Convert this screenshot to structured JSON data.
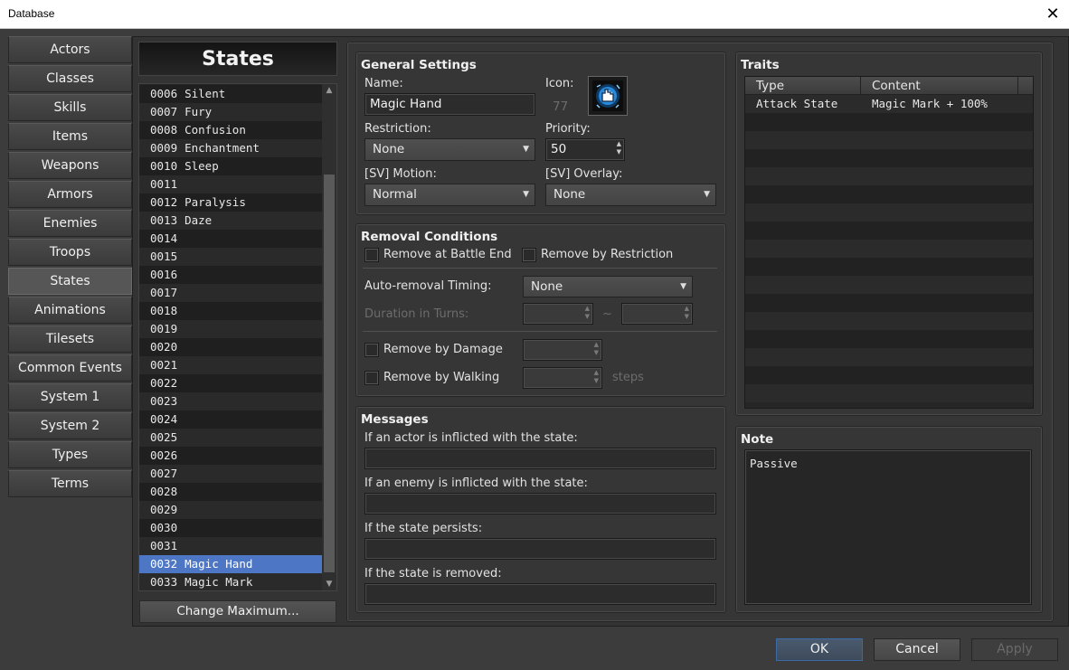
{
  "window": {
    "title": "Database"
  },
  "nav": {
    "items": [
      "Actors",
      "Classes",
      "Skills",
      "Items",
      "Weapons",
      "Armors",
      "Enemies",
      "Troops",
      "States",
      "Animations",
      "Tilesets",
      "Common Events",
      "System 1",
      "System 2",
      "Types",
      "Terms"
    ],
    "active": "States"
  },
  "list": {
    "title": "States",
    "rows": [
      {
        "id": "0006",
        "name": "Silent"
      },
      {
        "id": "0007",
        "name": "Fury"
      },
      {
        "id": "0008",
        "name": "Confusion"
      },
      {
        "id": "0009",
        "name": "Enchantment"
      },
      {
        "id": "0010",
        "name": "Sleep"
      },
      {
        "id": "0011",
        "name": ""
      },
      {
        "id": "0012",
        "name": "Paralysis"
      },
      {
        "id": "0013",
        "name": "Daze"
      },
      {
        "id": "0014",
        "name": ""
      },
      {
        "id": "0015",
        "name": ""
      },
      {
        "id": "0016",
        "name": ""
      },
      {
        "id": "0017",
        "name": ""
      },
      {
        "id": "0018",
        "name": ""
      },
      {
        "id": "0019",
        "name": ""
      },
      {
        "id": "0020",
        "name": ""
      },
      {
        "id": "0021",
        "name": ""
      },
      {
        "id": "0022",
        "name": ""
      },
      {
        "id": "0023",
        "name": ""
      },
      {
        "id": "0024",
        "name": ""
      },
      {
        "id": "0025",
        "name": ""
      },
      {
        "id": "0026",
        "name": ""
      },
      {
        "id": "0027",
        "name": ""
      },
      {
        "id": "0028",
        "name": ""
      },
      {
        "id": "0029",
        "name": ""
      },
      {
        "id": "0030",
        "name": ""
      },
      {
        "id": "0031",
        "name": ""
      },
      {
        "id": "0032",
        "name": "Magic Hand"
      },
      {
        "id": "0033",
        "name": "Magic Mark"
      }
    ],
    "selected_id": "0032",
    "change_max_label": "Change Maximum..."
  },
  "general": {
    "title": "General Settings",
    "name_label": "Name:",
    "name_value": "Magic Hand",
    "icon_label": "Icon:",
    "icon_index": "77",
    "icon_name": "magic-hand-icon",
    "restriction_label": "Restriction:",
    "restriction_value": "None",
    "priority_label": "Priority:",
    "priority_value": "50",
    "motion_label": "[SV] Motion:",
    "motion_value": "Normal",
    "overlay_label": "[SV] Overlay:",
    "overlay_value": "None"
  },
  "removal": {
    "title": "Removal Conditions",
    "battle_end_label": "Remove at Battle End",
    "restriction_label": "Remove by Restriction",
    "auto_timing_label": "Auto-removal Timing:",
    "auto_timing_value": "None",
    "duration_label": "Duration in Turns:",
    "tilde": "~",
    "damage_label": "Remove by Damage",
    "walking_label": "Remove by Walking",
    "steps_label": "steps"
  },
  "messages": {
    "title": "Messages",
    "actor_label": "If an actor is inflicted with the state:",
    "enemy_label": "If an enemy is inflicted with the state:",
    "persists_label": "If the state persists:",
    "removed_label": "If the state is removed:"
  },
  "traits": {
    "title": "Traits",
    "col_type": "Type",
    "col_content": "Content",
    "rows": [
      {
        "type": "Attack State",
        "content": "Magic Mark + 100%"
      }
    ],
    "visible_rows": 17
  },
  "note": {
    "title": "Note",
    "value": "Passive"
  },
  "buttons": {
    "ok": "OK",
    "cancel": "Cancel",
    "apply": "Apply"
  },
  "colors": {
    "selection": "#4d77c4",
    "panel": "#363636",
    "background": "#3c3c3c"
  }
}
